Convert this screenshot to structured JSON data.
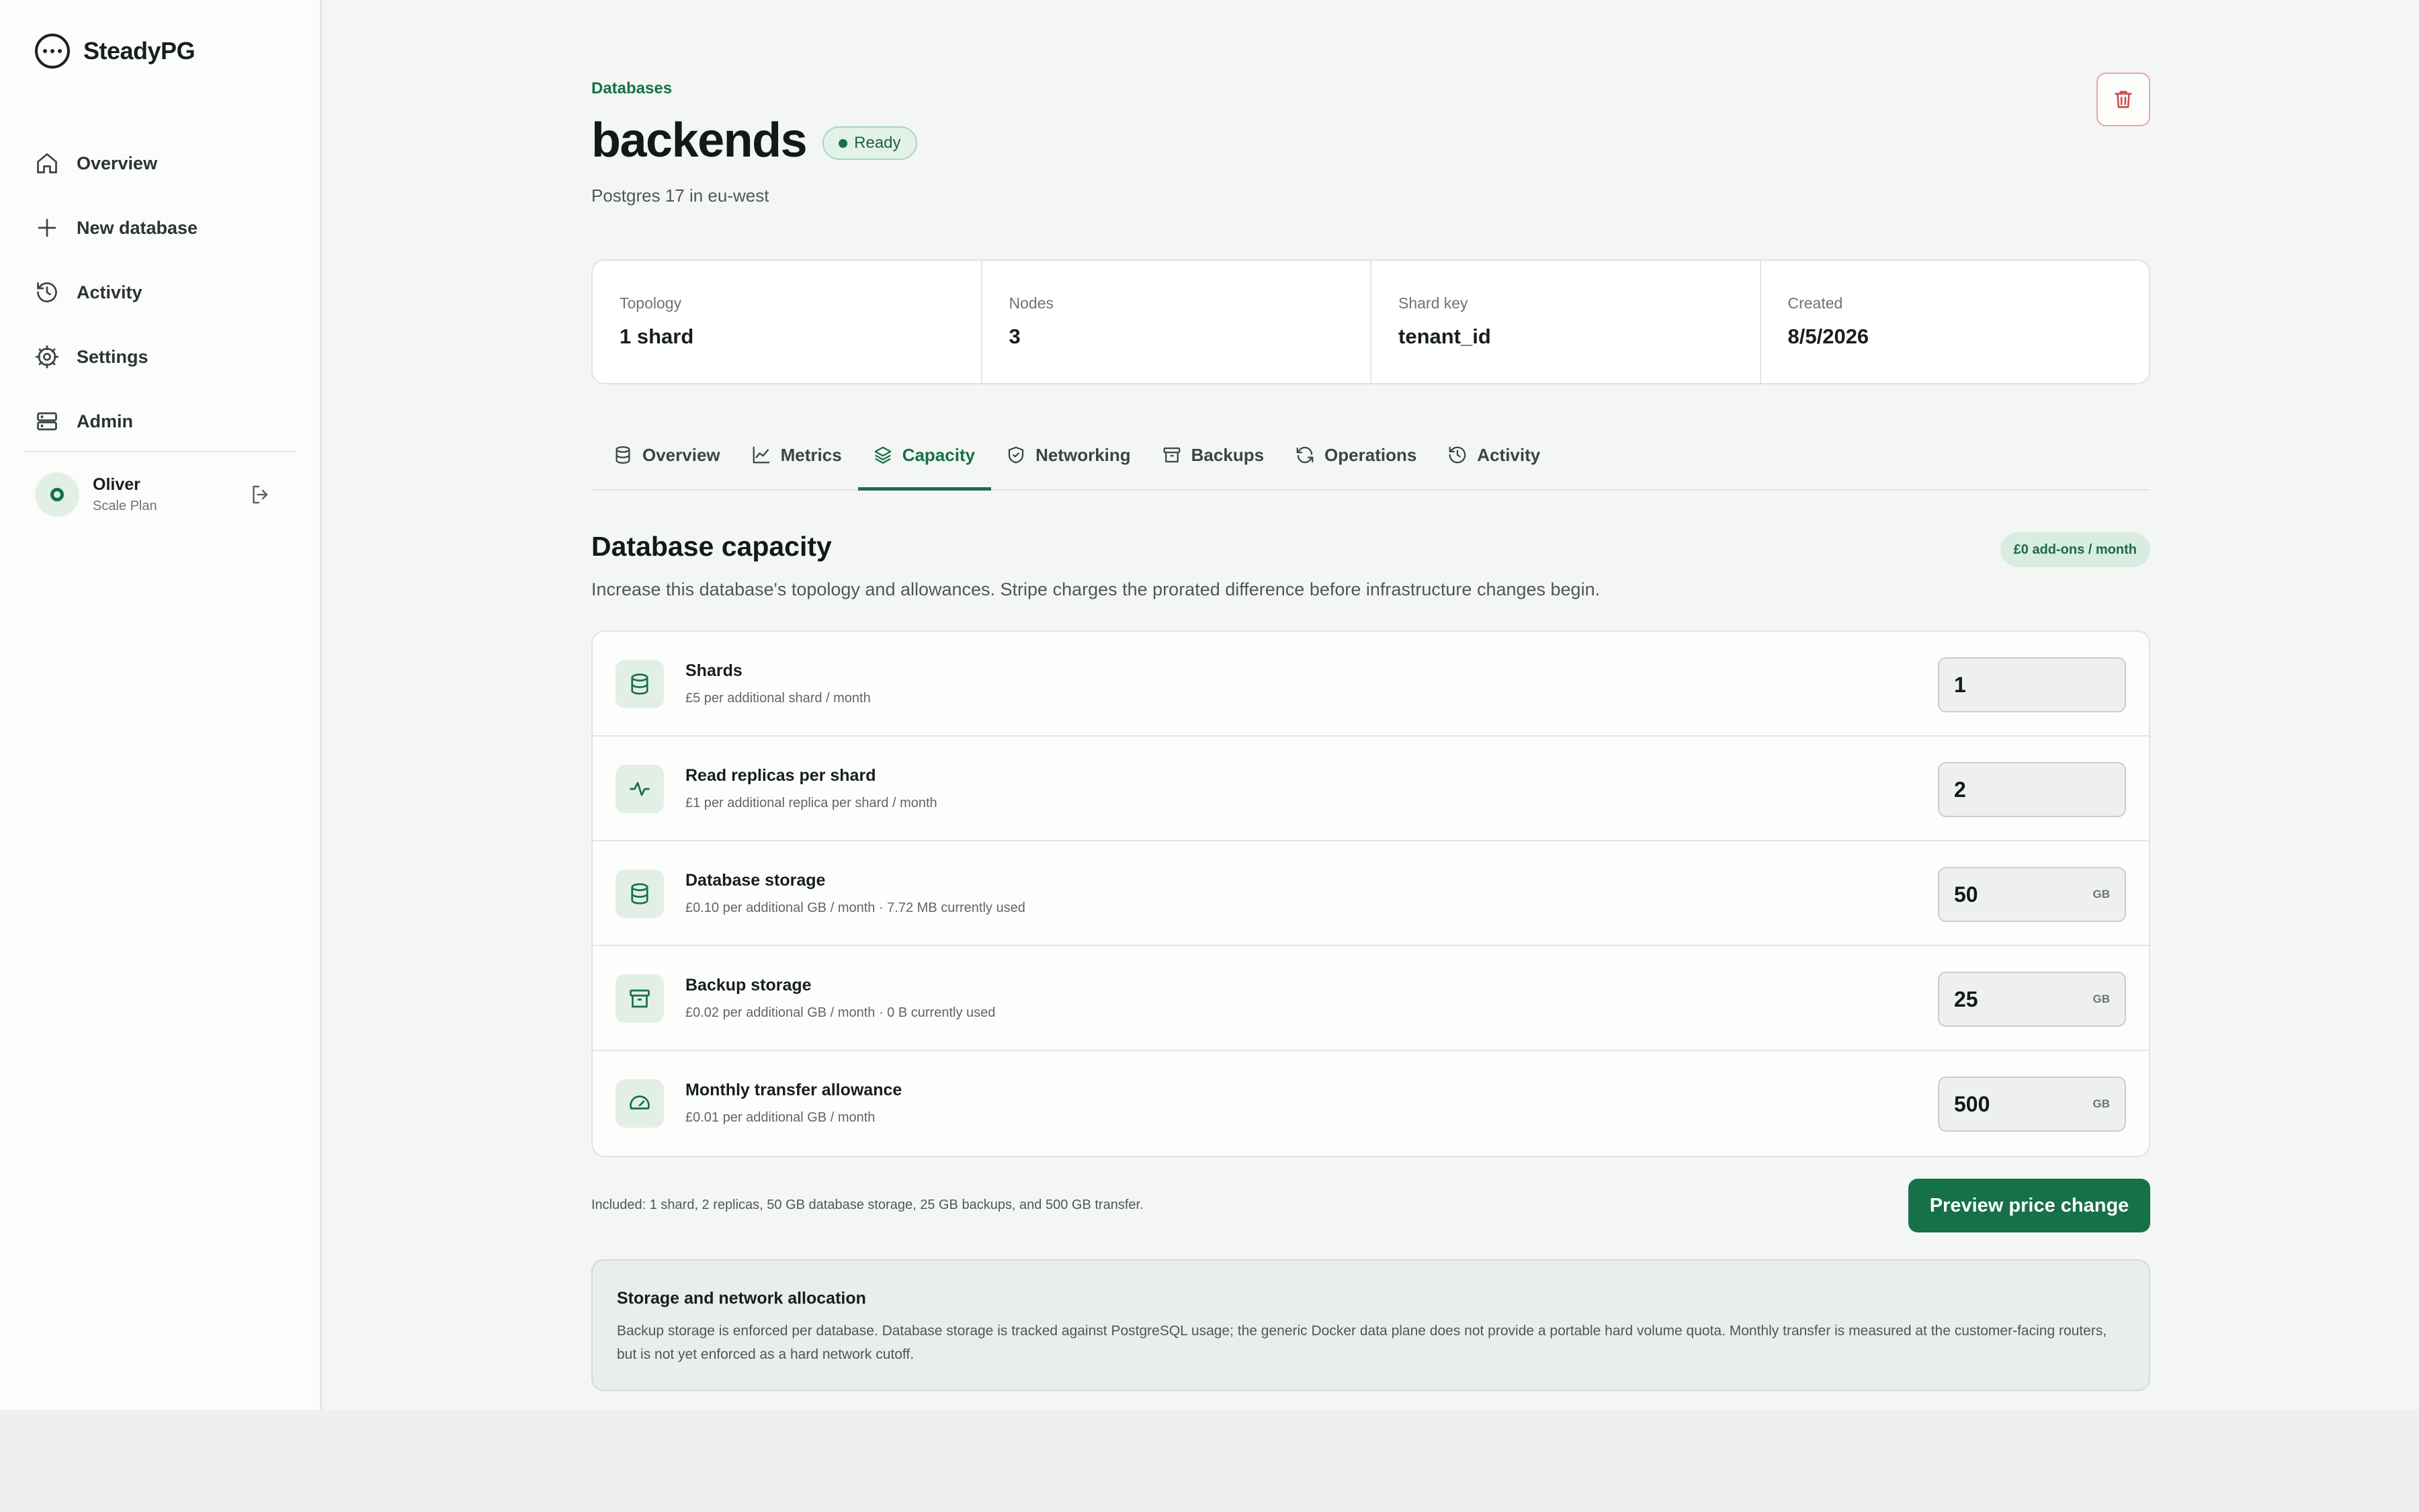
{
  "brand": {
    "name": "SteadyPG",
    "icon": "ellipsis-circle-icon"
  },
  "nav": [
    {
      "label": "Overview",
      "icon": "home-icon"
    },
    {
      "label": "New database",
      "icon": "plus-icon"
    },
    {
      "label": "Activity",
      "icon": "history-icon"
    },
    {
      "label": "Settings",
      "icon": "gear-icon"
    },
    {
      "label": "Admin",
      "icon": "server-icon"
    }
  ],
  "user": {
    "name": "Oliver",
    "plan": "Scale Plan"
  },
  "header": {
    "breadcrumb": "Databases",
    "title": "backends",
    "status": "Ready",
    "subtitle": "Postgres 17 in eu-west"
  },
  "stats": [
    {
      "label": "Topology",
      "value": "1 shard"
    },
    {
      "label": "Nodes",
      "value": "3"
    },
    {
      "label": "Shard key",
      "value": "tenant_id"
    },
    {
      "label": "Created",
      "value": "8/5/2026"
    }
  ],
  "tabs": [
    {
      "label": "Overview",
      "icon": "database-icon",
      "active": false
    },
    {
      "label": "Metrics",
      "icon": "line-chart-icon",
      "active": false
    },
    {
      "label": "Capacity",
      "icon": "layers-icon",
      "active": true
    },
    {
      "label": "Networking",
      "icon": "shield-icon",
      "active": false
    },
    {
      "label": "Backups",
      "icon": "archive-icon",
      "active": false
    },
    {
      "label": "Operations",
      "icon": "refresh-icon",
      "active": false
    },
    {
      "label": "Activity",
      "icon": "history-icon",
      "active": false
    }
  ],
  "capacity": {
    "title": "Database capacity",
    "addons": "£0 add-ons / month",
    "description": "Increase this database's topology and allowances. Stripe charges the prorated difference before infrastructure changes begin.",
    "rows": [
      {
        "name": "Shards",
        "note": "£5 per additional shard / month",
        "value": "1",
        "unit": "",
        "icon": "database-icon"
      },
      {
        "name": "Read replicas per shard",
        "note": "£1 per additional replica per shard / month",
        "value": "2",
        "unit": "",
        "icon": "activity-icon"
      },
      {
        "name": "Database storage",
        "note": "£0.10 per additional GB / month · 7.72 MB currently used",
        "value": "50",
        "unit": "GB",
        "icon": "database-icon"
      },
      {
        "name": "Backup storage",
        "note": "£0.02 per additional GB / month · 0 B currently used",
        "value": "25",
        "unit": "GB",
        "icon": "archive-icon"
      },
      {
        "name": "Monthly transfer allowance",
        "note": "£0.01 per additional GB / month",
        "value": "500",
        "unit": "GB",
        "icon": "gauge-icon"
      }
    ],
    "included": "Included: 1 shard, 2 replicas, 50 GB database storage, 25 GB backups, and 500 GB transfer.",
    "preview_label": "Preview price change"
  },
  "info": {
    "title": "Storage and network allocation",
    "text": "Backup storage is enforced per database. Database storage is tracked against PostgreSQL usage; the generic Docker data plane does not provide a portable hard volume quota. Monthly transfer is measured at the customer-facing routers, but is not yet enforced as a hard network cutoff."
  },
  "colors": {
    "accent": "#167048",
    "danger": "#c94a4a",
    "background": "#f4f6f5"
  }
}
